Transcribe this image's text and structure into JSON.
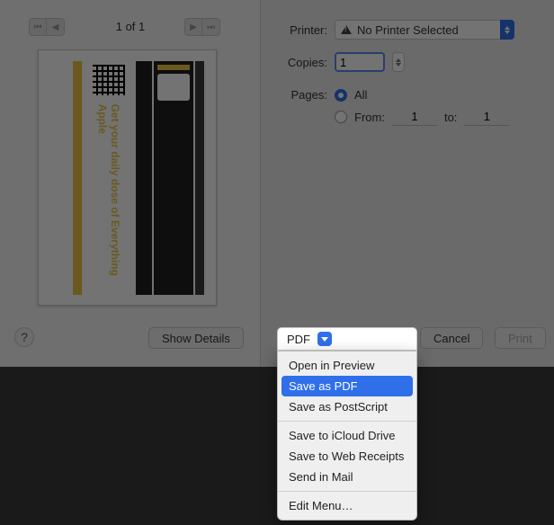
{
  "nav": {
    "page_indicator": "1 of 1"
  },
  "preview": {
    "headline": "Get your daily dose of Everything Apple"
  },
  "form": {
    "printer_label": "Printer:",
    "printer_value": "No Printer Selected",
    "copies_label": "Copies:",
    "copies_value": "1",
    "pages_label": "Pages:",
    "pages_all": "All",
    "pages_from_label": "From:",
    "pages_from_value": "1",
    "pages_to_label": "to:",
    "pages_to_value": "1"
  },
  "buttons": {
    "help": "?",
    "show_details": "Show Details",
    "cancel": "Cancel",
    "print": "Print",
    "pdf": "PDF"
  },
  "pdf_menu": {
    "open_preview": "Open in Preview",
    "save_pdf": "Save as PDF",
    "save_ps": "Save as PostScript",
    "save_icloud": "Save to iCloud Drive",
    "save_web": "Save to Web Receipts",
    "send_mail": "Send in Mail",
    "edit_menu": "Edit Menu…"
  }
}
